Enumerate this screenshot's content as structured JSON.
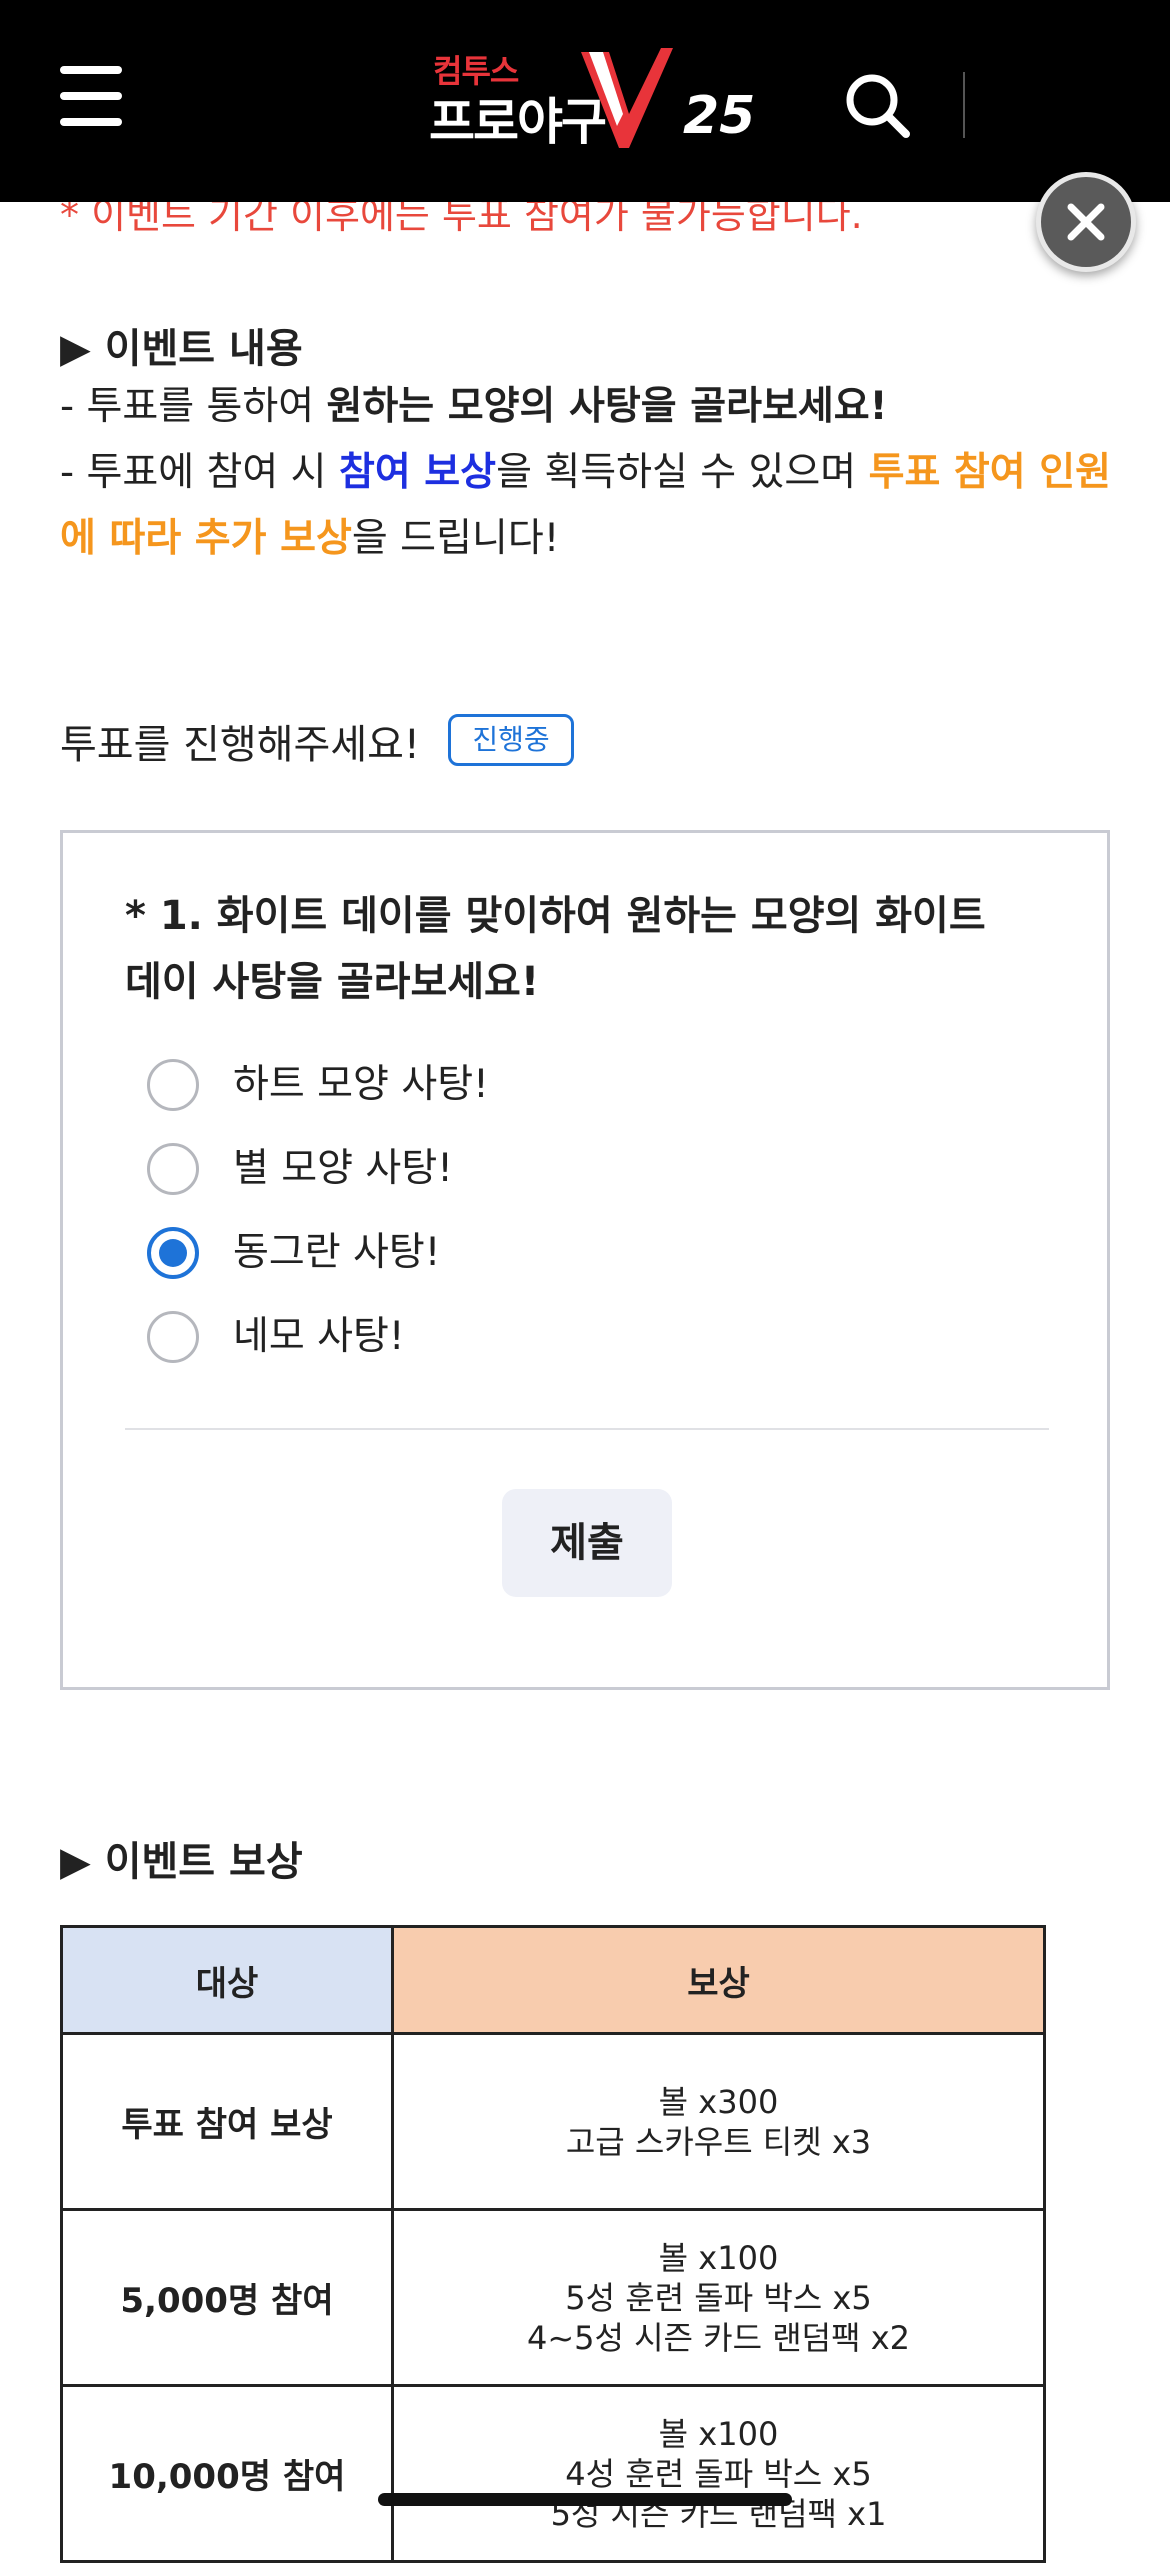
{
  "header": {
    "logo_small": "컴투스",
    "logo_big": "프로야구",
    "logo_number": "25"
  },
  "notice": "* 이벤트 기간 이후에는 투표 참여가 불가능합니다.",
  "event_content": {
    "title": "▶ 이벤트 내용",
    "line1_prefix": "- 투표를 통하여 ",
    "line1_bold": "원하는 모양의 사탕을 골라보세요!",
    "line2_prefix": "- 투표에 참여 시 ",
    "line2_blue": "참여 보상",
    "line2_mid": "을 획득하실 수 있으며 ",
    "line2_orange": "투표 참여 인원에 따라 추가 보상",
    "line2_suffix": "을 드립니다!"
  },
  "vote": {
    "label": "투표를 진행해주세요!",
    "status_badge": "진행중",
    "question": "* 1. 화이트 데이를 맞이하여 원하는 모양의 화이트 데이 사탕을 골라보세요!",
    "options": [
      {
        "label": "하트 모양 사탕!",
        "selected": false
      },
      {
        "label": "별 모양 사탕!",
        "selected": false
      },
      {
        "label": "동그란 사탕!",
        "selected": true
      },
      {
        "label": "네모 사탕!",
        "selected": false
      }
    ],
    "submit_label": "제출"
  },
  "reward": {
    "title": "▶ 이벤트 보상",
    "headers": [
      "대상",
      "보상"
    ],
    "rows": [
      {
        "target": "투표 참여 보상",
        "items": [
          "볼 x300",
          "고급 스카우트 티켓 x3"
        ]
      },
      {
        "target": "5,000명 참여",
        "items": [
          "볼 x100",
          "5성 훈련 돌파 박스 x5",
          "4~5성 시즌 카드 랜덤팩 x2"
        ]
      },
      {
        "target": "10,000명 참여",
        "items": [
          "볼 x100",
          "4성 훈련 돌파 박스 x5",
          "5성 시즌 카드 랜덤팩 x1"
        ]
      }
    ]
  },
  "colors": {
    "notice_red": "#e8483c",
    "accent_blue": "#1d2fe0",
    "accent_orange": "#f5961d",
    "radio_blue": "#1e73d8",
    "header_target_bg": "#d8e2f3",
    "header_reward_bg": "#f8ccae"
  },
  "icons": [
    "hamburger-menu-icon",
    "search-icon",
    "close-icon"
  ]
}
